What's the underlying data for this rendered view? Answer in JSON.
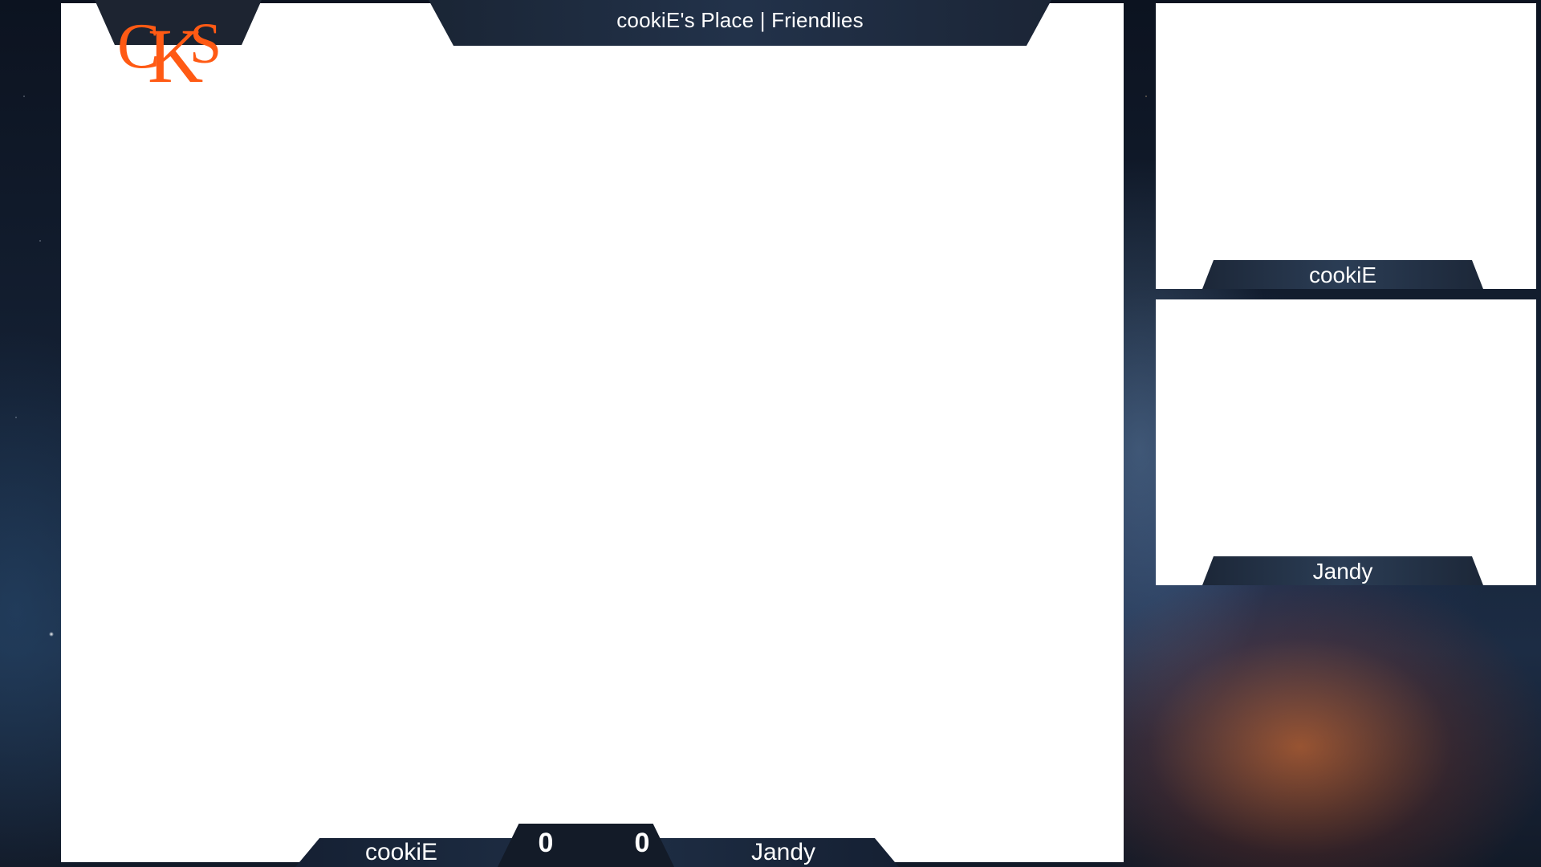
{
  "overlay": {
    "title": "cookiE's Place | Friendlies",
    "logo_text": "CKS",
    "logo_color": "#ff5a14",
    "player1": {
      "camera_name": "cookiE",
      "score_name": "cookiE",
      "score": "0"
    },
    "player2": {
      "camera_name": "Jandy",
      "score_name": "Jandy",
      "score": "0"
    }
  }
}
